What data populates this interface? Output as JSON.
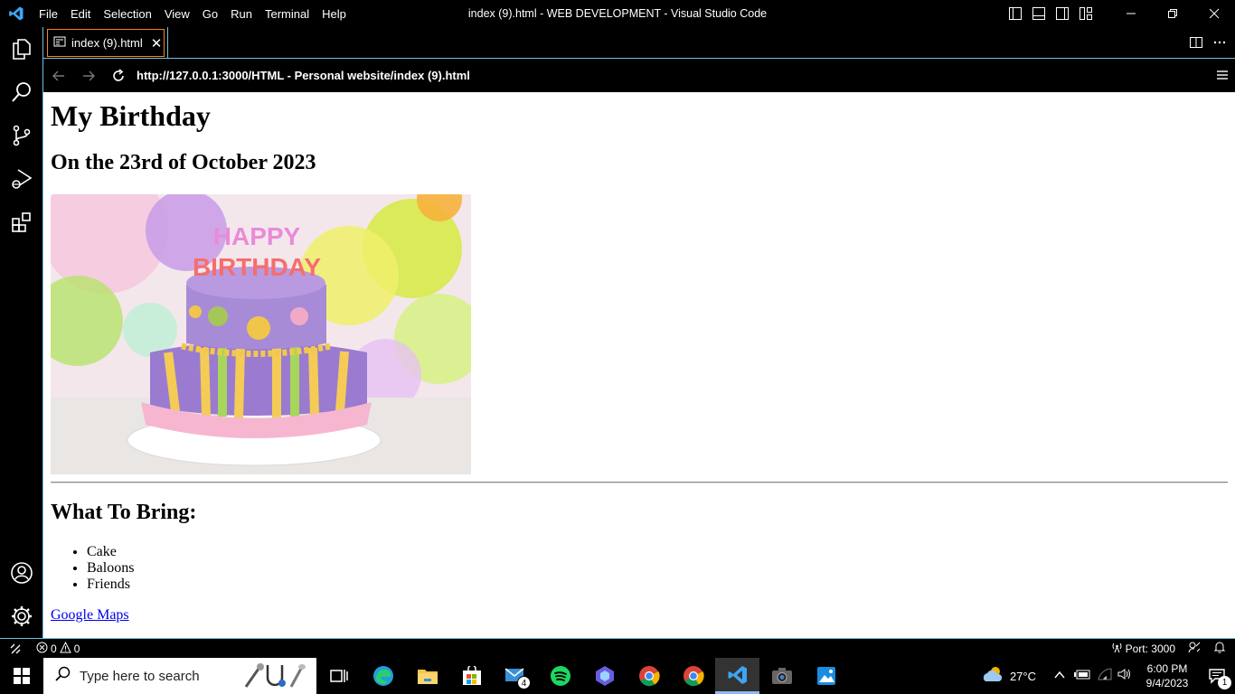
{
  "titlebar": {
    "menu": [
      "File",
      "Edit",
      "Selection",
      "View",
      "Go",
      "Run",
      "Terminal",
      "Help"
    ],
    "window_title": "index (9).html - WEB DEVELOPMENT - Visual Studio Code"
  },
  "tab": {
    "label": "index (9).html"
  },
  "browser": {
    "url": "http://127.0.0.1:3000/HTML - Personal website/index (9).html"
  },
  "page": {
    "heading": "My Birthday",
    "date_heading": "On the 23rd of October 2023",
    "cake_text": "HAPPY BIRTHDAY",
    "bring_heading": "What To Bring:",
    "items": [
      "Cake",
      "Baloons",
      "Friends"
    ],
    "link": "Google Maps"
  },
  "statusbar": {
    "errors": "0",
    "warnings": "0",
    "port": "Port: 3000"
  },
  "taskbar": {
    "search_placeholder": "Type here to search",
    "mail_badge": "4",
    "weather": "27°C",
    "time": "6:00 PM",
    "date": "9/4/2023",
    "notification_count": "1"
  },
  "colors": {
    "accent_border": "#6fc3df",
    "tab_border": "#f38518",
    "link": "#0000ee"
  }
}
